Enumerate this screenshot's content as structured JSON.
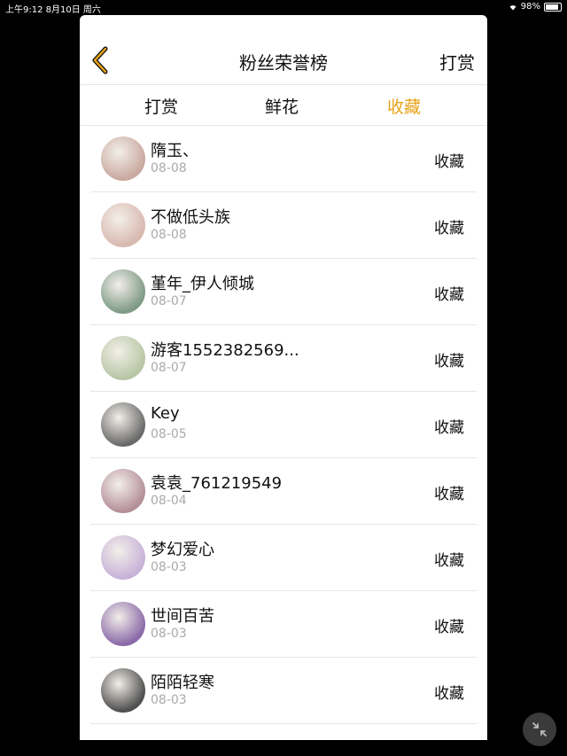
{
  "status_bar": {
    "time": "上午9:12",
    "date": "8月10日 周六",
    "battery": "98%",
    "battery_level": 0.98
  },
  "nav": {
    "title": "粉丝荣誉榜",
    "right_label": "打赏",
    "back_icon": "chevron-left-icon",
    "accent": "#e6a317"
  },
  "tabs": [
    {
      "label": "打赏",
      "active": false
    },
    {
      "label": "鲜花",
      "active": false
    },
    {
      "label": "收藏",
      "active": true
    }
  ],
  "list": [
    {
      "name": "隋玉、",
      "date": "08-08",
      "action": "收藏",
      "avatar_color": "#c9a9a0"
    },
    {
      "name": "不做低头族",
      "date": "08-08",
      "action": "收藏",
      "avatar_color": "#d8b9b0"
    },
    {
      "name": "堇年_伊人倾城",
      "date": "08-07",
      "action": "收藏",
      "avatar_color": "#7f9a87"
    },
    {
      "name": "游客1552382569...",
      "date": "08-07",
      "action": "收藏",
      "avatar_color": "#b7c6a4"
    },
    {
      "name": "Key",
      "date": "08-05",
      "action": "收藏",
      "avatar_color": "#6a6a6a"
    },
    {
      "name": "袁袁_761219549",
      "date": "08-04",
      "action": "收藏",
      "avatar_color": "#b48f9a"
    },
    {
      "name": "梦幻爱心",
      "date": "08-03",
      "action": "收藏",
      "avatar_color": "#c7b2d8"
    },
    {
      "name": "世间百苦",
      "date": "08-03",
      "action": "收藏",
      "avatar_color": "#8a6aa8"
    },
    {
      "name": "陌陌轻寒",
      "date": "08-03",
      "action": "收藏",
      "avatar_color": "#4f4f4f"
    }
  ]
}
